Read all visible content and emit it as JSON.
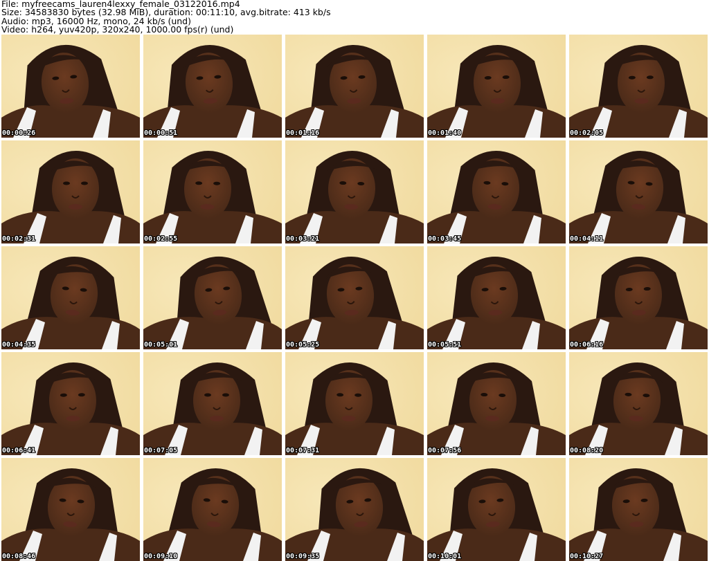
{
  "header": {
    "file_line": "File: myfreecams_lauren4lexxy_female_03122016.mp4",
    "size_line": "Size: 34583830 bytes (32.98 MiB), duration: 00:11:10, avg.bitrate: 413 kb/s",
    "audio_line": "Audio: mp3, 16000 Hz, mono, 24 kb/s (und)",
    "video_line": "Video: h264, yuv420p, 320x240, 1000.00 fps(r) (und)"
  },
  "thumbnails": [
    {
      "timestamp": "00:00:26"
    },
    {
      "timestamp": "00:00:51"
    },
    {
      "timestamp": "00:01:16"
    },
    {
      "timestamp": "00:01:40"
    },
    {
      "timestamp": "00:02:05"
    },
    {
      "timestamp": "00:02:31"
    },
    {
      "timestamp": "00:02:55"
    },
    {
      "timestamp": "00:03:21"
    },
    {
      "timestamp": "00:03:45"
    },
    {
      "timestamp": "00:04:11"
    },
    {
      "timestamp": "00:04:35"
    },
    {
      "timestamp": "00:05:01"
    },
    {
      "timestamp": "00:05:25"
    },
    {
      "timestamp": "00:05:51"
    },
    {
      "timestamp": "00:06:16"
    },
    {
      "timestamp": "00:06:41"
    },
    {
      "timestamp": "00:07:05"
    },
    {
      "timestamp": "00:07:31"
    },
    {
      "timestamp": "00:07:56"
    },
    {
      "timestamp": "00:08:20"
    },
    {
      "timestamp": "00:08:46"
    },
    {
      "timestamp": "00:09:10"
    },
    {
      "timestamp": "00:09:35"
    },
    {
      "timestamp": "00:10:01"
    },
    {
      "timestamp": "00:10:27"
    }
  ],
  "colors": {
    "background": "#f1dba0",
    "hair": "#2a1810",
    "skin": "#4a2a18",
    "shirt": "#f2f2f2"
  }
}
